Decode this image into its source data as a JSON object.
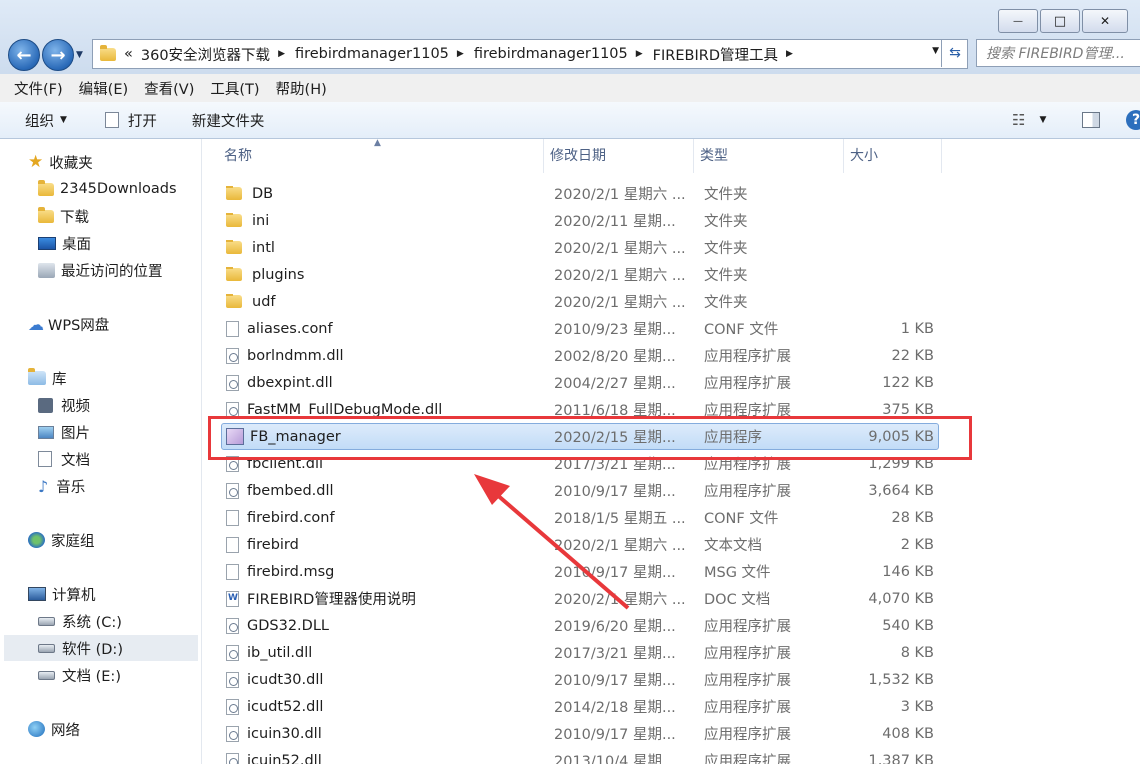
{
  "window": {
    "buttons": [
      {
        "name": "minimize-button",
        "glyph": "—"
      },
      {
        "name": "maximize-button",
        "glyph": "□"
      },
      {
        "name": "close-button",
        "glyph": "✕"
      }
    ]
  },
  "address": {
    "overflow": "«",
    "segments": [
      "360安全浏览器下载",
      "firebirdmanager1105",
      "firebirdmanager1105",
      "FIREBIRD管理工具"
    ],
    "search_placeholder": "搜索 FIREBIRD管理..."
  },
  "menu": [
    "文件(F)",
    "编辑(E)",
    "查看(V)",
    "工具(T)",
    "帮助(H)"
  ],
  "toolbar": {
    "organize": "组织",
    "open": "打开",
    "new_folder": "新建文件夹"
  },
  "sidebar": {
    "favorites": "收藏夹",
    "fav_items": [
      "2345Downloads",
      "下载",
      "桌面",
      "最近访问的位置"
    ],
    "wps": "WPS网盘",
    "library": "库",
    "lib_items": [
      "视频",
      "图片",
      "文档",
      "音乐"
    ],
    "homegroup": "家庭组",
    "computer": "计算机",
    "drives": [
      "系统 (C:)",
      "软件 (D:)",
      "文档 (E:)"
    ],
    "network": "网络"
  },
  "columns": {
    "name": "名称",
    "date": "修改日期",
    "type": "类型",
    "size": "大小"
  },
  "files": [
    {
      "name": "DB",
      "date": "2020/2/1 星期六 ...",
      "type": "文件夹",
      "size": "",
      "kind": "folder"
    },
    {
      "name": "ini",
      "date": "2020/2/11 星期...",
      "type": "文件夹",
      "size": "",
      "kind": "folder"
    },
    {
      "name": "intl",
      "date": "2020/2/1 星期六 ...",
      "type": "文件夹",
      "size": "",
      "kind": "folder"
    },
    {
      "name": "plugins",
      "date": "2020/2/1 星期六 ...",
      "type": "文件夹",
      "size": "",
      "kind": "folder"
    },
    {
      "name": "udf",
      "date": "2020/2/1 星期六 ...",
      "type": "文件夹",
      "size": "",
      "kind": "folder"
    },
    {
      "name": "aliases.conf",
      "date": "2010/9/23 星期...",
      "type": "CONF 文件",
      "size": "1 KB",
      "kind": "file"
    },
    {
      "name": "borlndmm.dll",
      "date": "2002/8/20 星期...",
      "type": "应用程序扩展",
      "size": "22 KB",
      "kind": "dll"
    },
    {
      "name": "dbexpint.dll",
      "date": "2004/2/27 星期...",
      "type": "应用程序扩展",
      "size": "122 KB",
      "kind": "dll"
    },
    {
      "name": "FastMM_FullDebugMode.dll",
      "date": "2011/6/18 星期...",
      "type": "应用程序扩展",
      "size": "375 KB",
      "kind": "dll"
    },
    {
      "name": "FB_manager",
      "date": "2020/2/15 星期...",
      "type": "应用程序",
      "size": "9,005 KB",
      "kind": "app"
    },
    {
      "name": "fbclient.dll",
      "date": "2017/3/21 星期...",
      "type": "应用程序扩展",
      "size": "1,299 KB",
      "kind": "dll"
    },
    {
      "name": "fbembed.dll",
      "date": "2010/9/17 星期...",
      "type": "应用程序扩展",
      "size": "3,664 KB",
      "kind": "dll"
    },
    {
      "name": "firebird.conf",
      "date": "2018/1/5 星期五 ...",
      "type": "CONF 文件",
      "size": "28 KB",
      "kind": "file"
    },
    {
      "name": "firebird",
      "date": "2020/2/1 星期六 ...",
      "type": "文本文档",
      "size": "2 KB",
      "kind": "file"
    },
    {
      "name": "firebird.msg",
      "date": "2010/9/17 星期...",
      "type": "MSG 文件",
      "size": "146 KB",
      "kind": "file"
    },
    {
      "name": "FIREBIRD管理器使用说明",
      "date": "2020/2/1 星期六 ...",
      "type": "DOC 文档",
      "size": "4,070 KB",
      "kind": "doc"
    },
    {
      "name": "GDS32.DLL",
      "date": "2019/6/20 星期...",
      "type": "应用程序扩展",
      "size": "540 KB",
      "kind": "dll"
    },
    {
      "name": "ib_util.dll",
      "date": "2017/3/21 星期...",
      "type": "应用程序扩展",
      "size": "8 KB",
      "kind": "dll"
    },
    {
      "name": "icudt30.dll",
      "date": "2010/9/17 星期...",
      "type": "应用程序扩展",
      "size": "1,532 KB",
      "kind": "dll"
    },
    {
      "name": "icudt52.dll",
      "date": "2014/2/18 星期...",
      "type": "应用程序扩展",
      "size": "3 KB",
      "kind": "dll"
    },
    {
      "name": "icuin30.dll",
      "date": "2010/9/17 星期...",
      "type": "应用程序扩展",
      "size": "408 KB",
      "kind": "dll"
    },
    {
      "name": "icuin52.dll",
      "date": "2013/10/4 星期...",
      "type": "应用程序扩展",
      "size": "1,387 KB",
      "kind": "dll"
    }
  ],
  "selected_file": "FB_manager",
  "annotation_color": "#e8383b"
}
